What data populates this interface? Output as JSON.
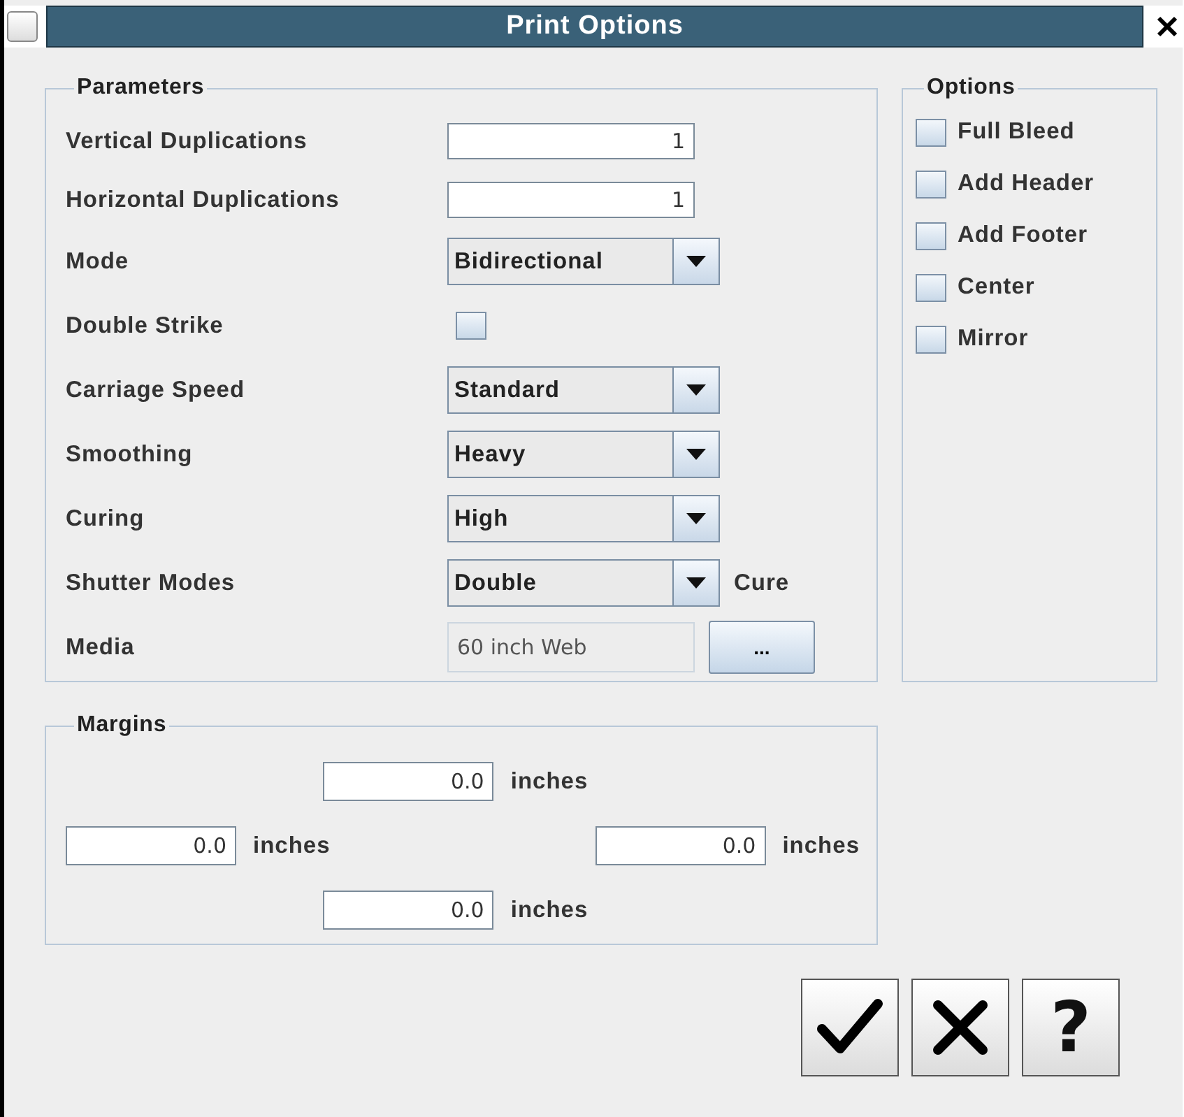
{
  "window": {
    "title": "Print Options"
  },
  "parameters": {
    "title": "Parameters",
    "rows": [
      {
        "kind": "text",
        "label": "Vertical Duplications",
        "value": "1"
      },
      {
        "kind": "text",
        "label": "Horizontal Duplications",
        "value": "1"
      },
      {
        "kind": "combo",
        "label": "Mode",
        "value": "Bidirectional"
      },
      {
        "kind": "checkbox",
        "label": "Double Strike",
        "checked": false
      },
      {
        "kind": "combo",
        "label": "Carriage Speed",
        "value": "Standard"
      },
      {
        "kind": "combo",
        "label": "Smoothing",
        "value": "Heavy"
      },
      {
        "kind": "combo",
        "label": "Curing",
        "value": "High"
      },
      {
        "kind": "combo",
        "label": "Shutter Modes",
        "value": "Double",
        "suffix": "Cure"
      },
      {
        "kind": "media",
        "label": "Media",
        "value": "60 inch Web",
        "button": "..."
      }
    ]
  },
  "options": {
    "title": "Options",
    "items": [
      {
        "label": "Full Bleed",
        "checked": false
      },
      {
        "label": "Add Header",
        "checked": false
      },
      {
        "label": "Add Footer",
        "checked": false
      },
      {
        "label": "Center",
        "checked": false
      },
      {
        "label": "Mirror",
        "checked": false
      }
    ]
  },
  "margins": {
    "title": "Margins",
    "fields": [
      {
        "value": "0.0",
        "unit": "inches"
      },
      {
        "value": "0.0",
        "unit": "inches"
      },
      {
        "value": "0.0",
        "unit": "inches"
      },
      {
        "value": "0.0",
        "unit": "inches"
      }
    ]
  },
  "buttons": [
    {
      "kind": "ok"
    },
    {
      "kind": "cancel"
    },
    {
      "kind": "help",
      "label": "?"
    }
  ]
}
